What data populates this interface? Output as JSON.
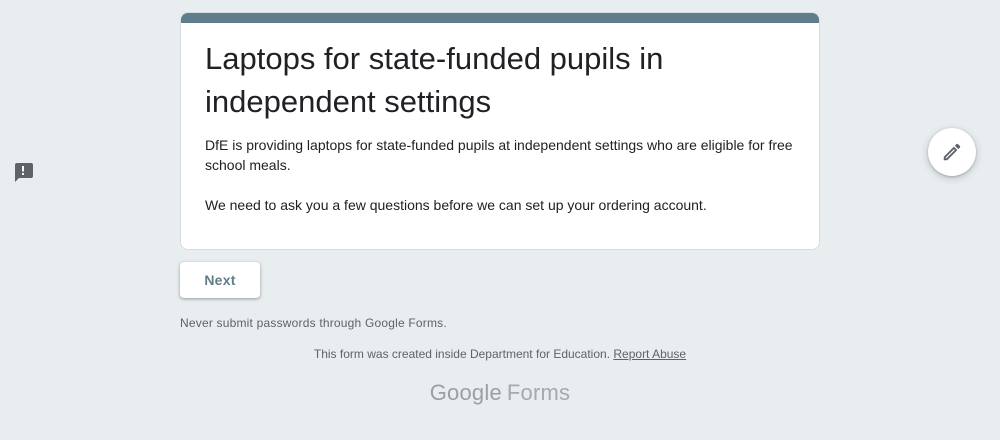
{
  "form": {
    "title": "Laptops for state-funded pupils in independent settings",
    "description": [
      "DfE is providing laptops for state-funded pupils at independent settings who are eligible for free school meals.",
      "We need to ask you a few questions before we can set up your ordering account."
    ],
    "accent_color": "#607d8b"
  },
  "actions": {
    "next_label": "Next"
  },
  "footer": {
    "password_warning": "Never submit passwords through Google Forms.",
    "created_text": "This form was created inside Department for Education.",
    "report_abuse_label": "Report Abuse",
    "logo_google": "Google",
    "logo_forms": "Forms"
  },
  "icons": {
    "feedback": "feedback-icon",
    "edit": "pencil-icon"
  },
  "colors": {
    "background": "#e8edef",
    "accent": "#607d8b"
  }
}
